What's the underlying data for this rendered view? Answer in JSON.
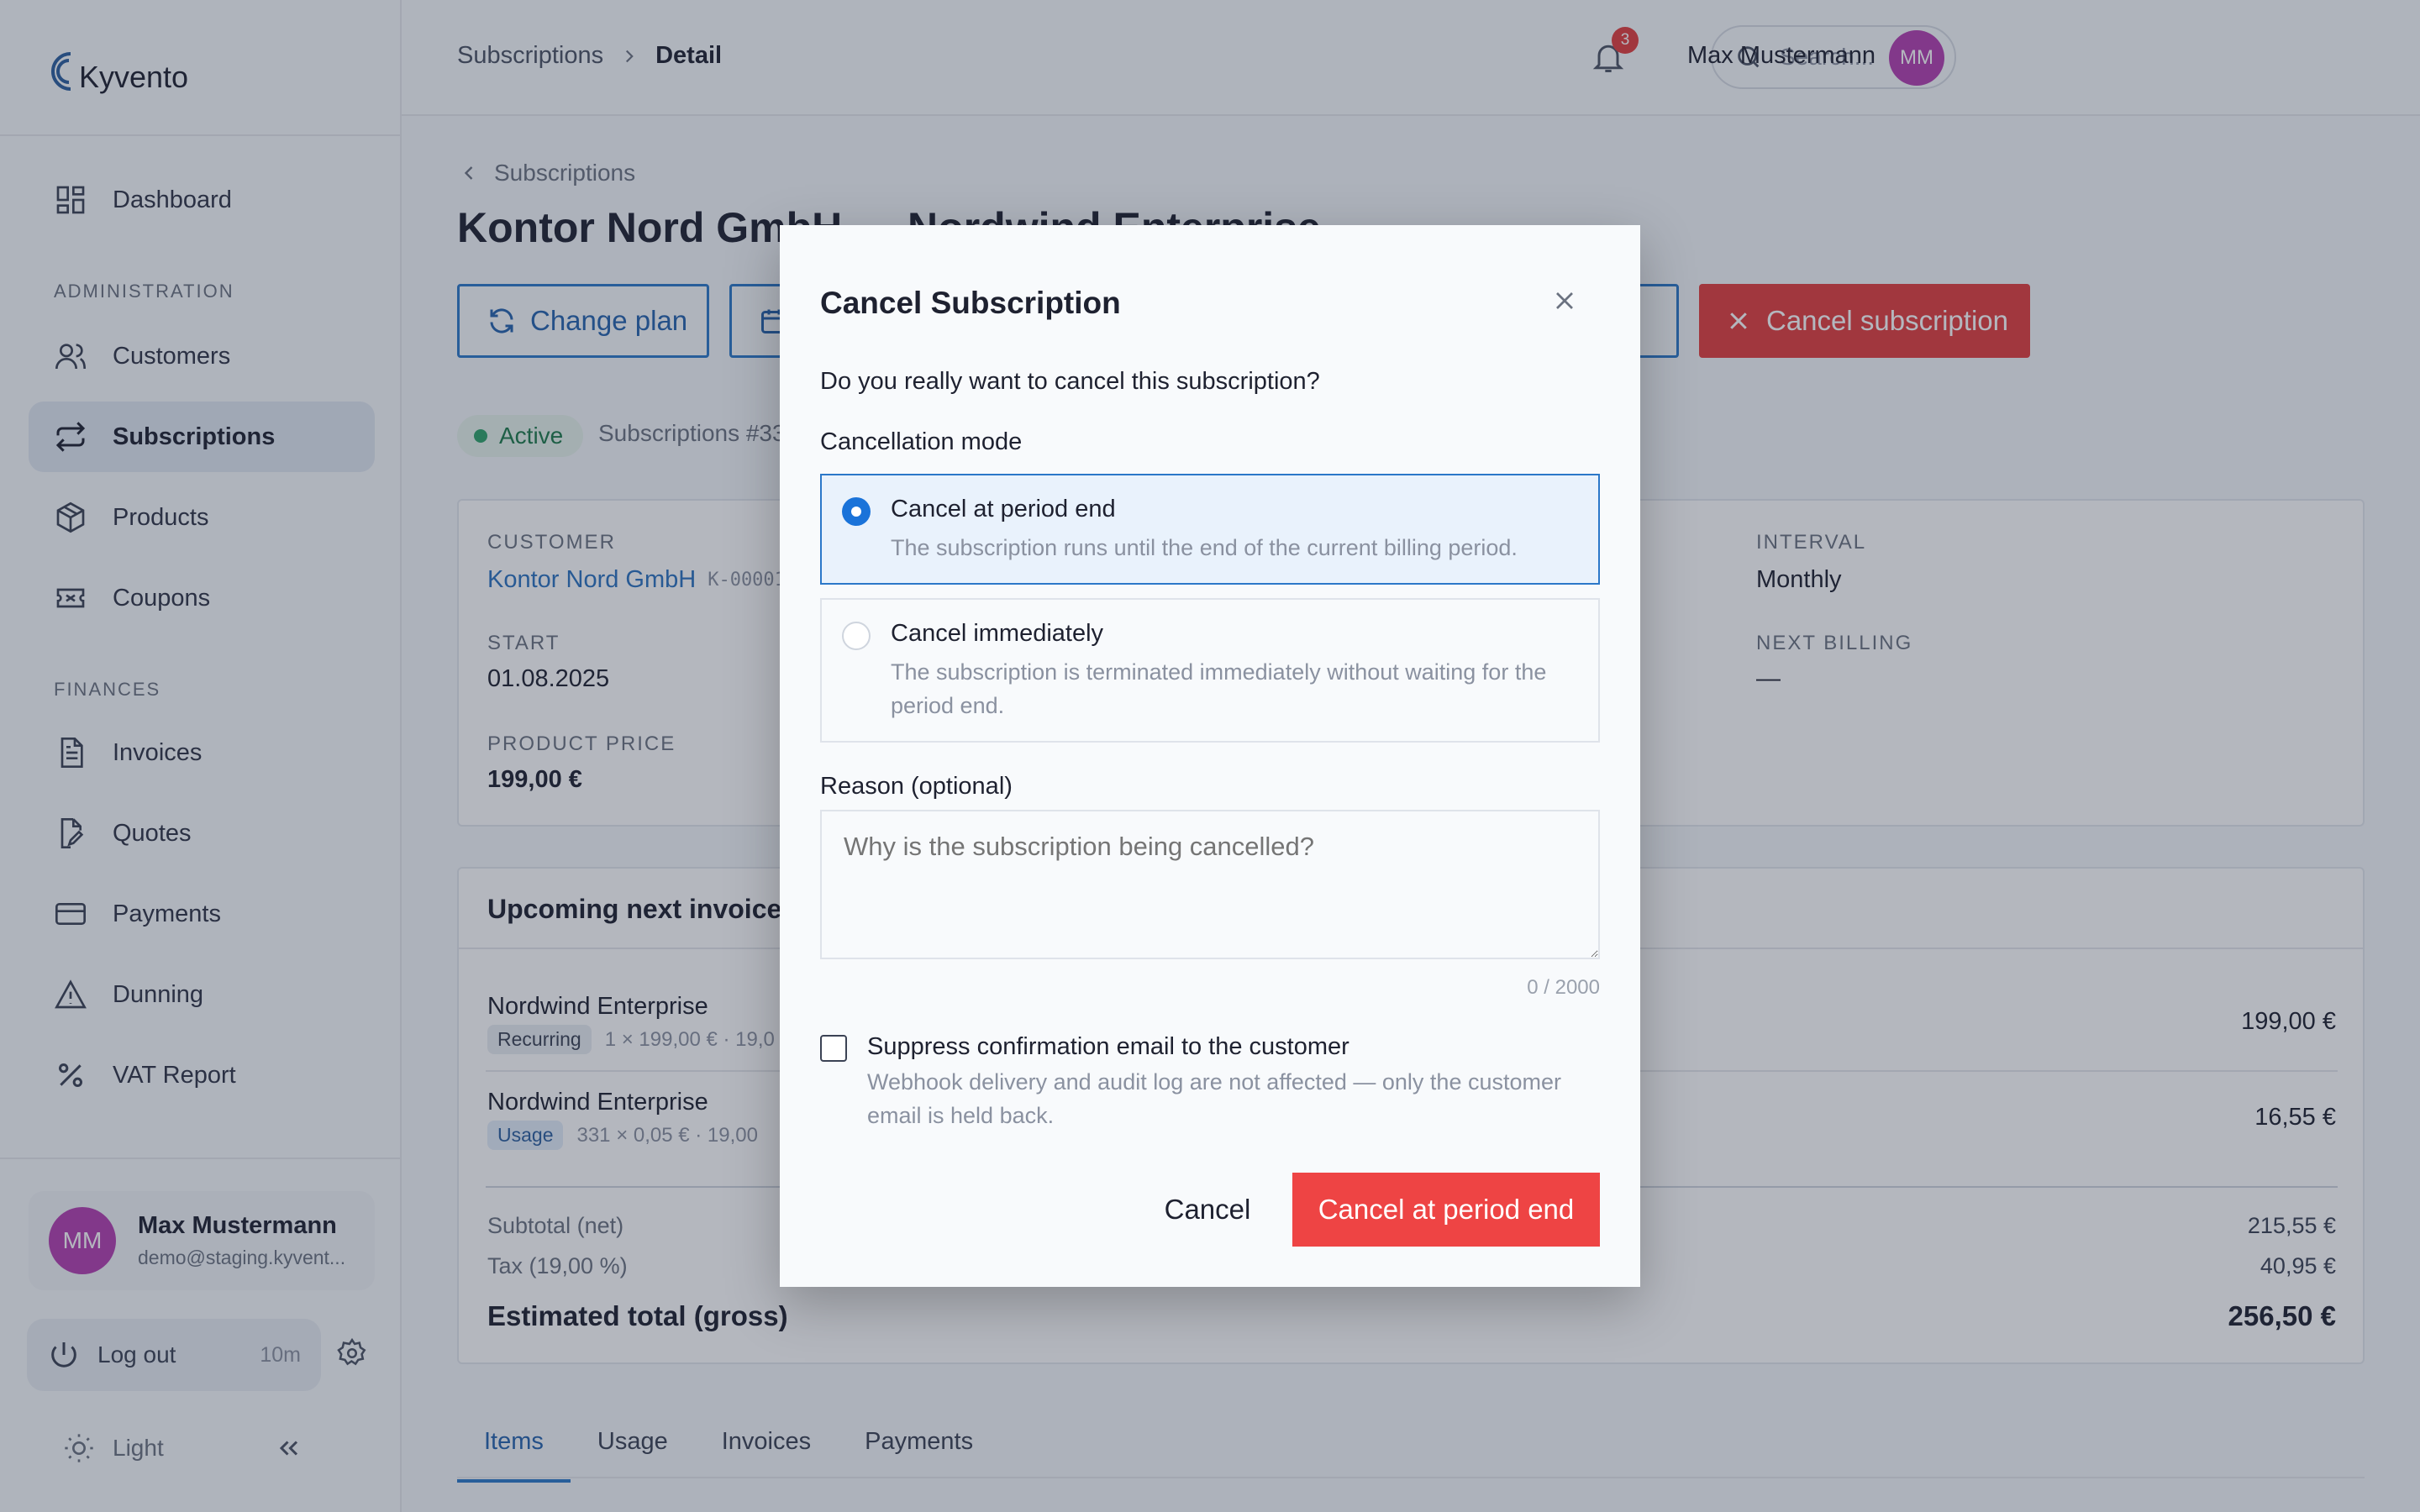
{
  "app": {
    "name": "Kyvento"
  },
  "sidebar": {
    "items": [
      {
        "label": "Dashboard",
        "icon": "dashboard-icon"
      },
      {
        "label": "Customers",
        "icon": "users-icon"
      },
      {
        "label": "Subscriptions",
        "icon": "repeat-icon",
        "active": true
      },
      {
        "label": "Products",
        "icon": "box-icon"
      },
      {
        "label": "Coupons",
        "icon": "ticket-icon"
      },
      {
        "label": "Invoices",
        "icon": "document-icon"
      },
      {
        "label": "Quotes",
        "icon": "document-edit-icon"
      },
      {
        "label": "Payments",
        "icon": "credit-card-icon"
      },
      {
        "label": "Dunning",
        "icon": "warning-icon"
      },
      {
        "label": "VAT Report",
        "icon": "percent-icon"
      }
    ],
    "sections": {
      "administration": "ADMINISTRATION",
      "finances": "FINANCES"
    },
    "user": {
      "initials": "MM",
      "name": "Max Mustermann",
      "email": "demo@staging.kyvent..."
    },
    "logout": {
      "label": "Log out",
      "timer": "10m"
    },
    "theme": {
      "label": "Light"
    }
  },
  "header": {
    "breadcrumb": {
      "parent": "Subscriptions",
      "current": "Detail"
    },
    "search": {
      "placeholder": "Search...",
      "shortcut": "⌘K"
    },
    "notifications": {
      "count": "3"
    },
    "user": {
      "name": "Max Mustermann",
      "initials": "MM"
    }
  },
  "page": {
    "back_label": "Subscriptions",
    "title": "Kontor Nord GmbH — Nordwind Enterprise",
    "actions": {
      "change_plan": "Change plan",
      "cancel_subscription": "Cancel subscription"
    },
    "status": "Active",
    "subscription_id": "Subscriptions #33",
    "details": {
      "customer_label": "CUSTOMER",
      "customer_name": "Kontor Nord GmbH",
      "customer_number": "K-00001",
      "start_label": "START",
      "start_value": "01.08.2025",
      "product_price_label": "PRODUCT PRICE",
      "product_price_value": "199,00 €",
      "interval_label": "INTERVAL",
      "interval_value": "Monthly",
      "next_billing_label": "NEXT BILLING",
      "next_billing_value": "—"
    },
    "invoice": {
      "title": "Upcoming next invoice",
      "lines": [
        {
          "name": "Nordwind Enterprise",
          "badge": "Recurring",
          "meta": "1 × 199,00 €  ·  19,0",
          "amount": "199,00 €"
        },
        {
          "name": "Nordwind Enterprise",
          "badge": "Usage",
          "meta": "331 × 0,05 €  ·  19,00",
          "amount": "16,55 €"
        }
      ],
      "subtotal_label": "Subtotal (net)",
      "subtotal_value": "215,55 €",
      "tax_label": "Tax (19,00 %)",
      "tax_value": "40,95 €",
      "total_label": "Estimated total (gross)",
      "total_value": "256,50 €"
    },
    "tabs": [
      "Items",
      "Usage",
      "Invoices",
      "Payments"
    ]
  },
  "modal": {
    "title": "Cancel Subscription",
    "question": "Do you really want to cancel this subscription?",
    "mode_label": "Cancellation mode",
    "options": [
      {
        "title": "Cancel at period end",
        "description": "The subscription runs until the end of the current billing period."
      },
      {
        "title": "Cancel immediately",
        "description": "The subscription is terminated immediately without waiting for the period end."
      }
    ],
    "reason_label": "Reason (optional)",
    "reason_placeholder": "Why is the subscription being cancelled?",
    "char_count": "0 / 2000",
    "suppress_title": "Suppress confirmation email to the customer",
    "suppress_desc": "Webhook delivery and audit log are not affected — only the customer email is held back.",
    "cancel_label": "Cancel",
    "confirm_label": "Cancel at period end"
  },
  "colors": {
    "accent": "#2b78c9",
    "danger": "#e23d3d",
    "active_status": "#2ea36a",
    "avatar": "#b43fb0"
  }
}
